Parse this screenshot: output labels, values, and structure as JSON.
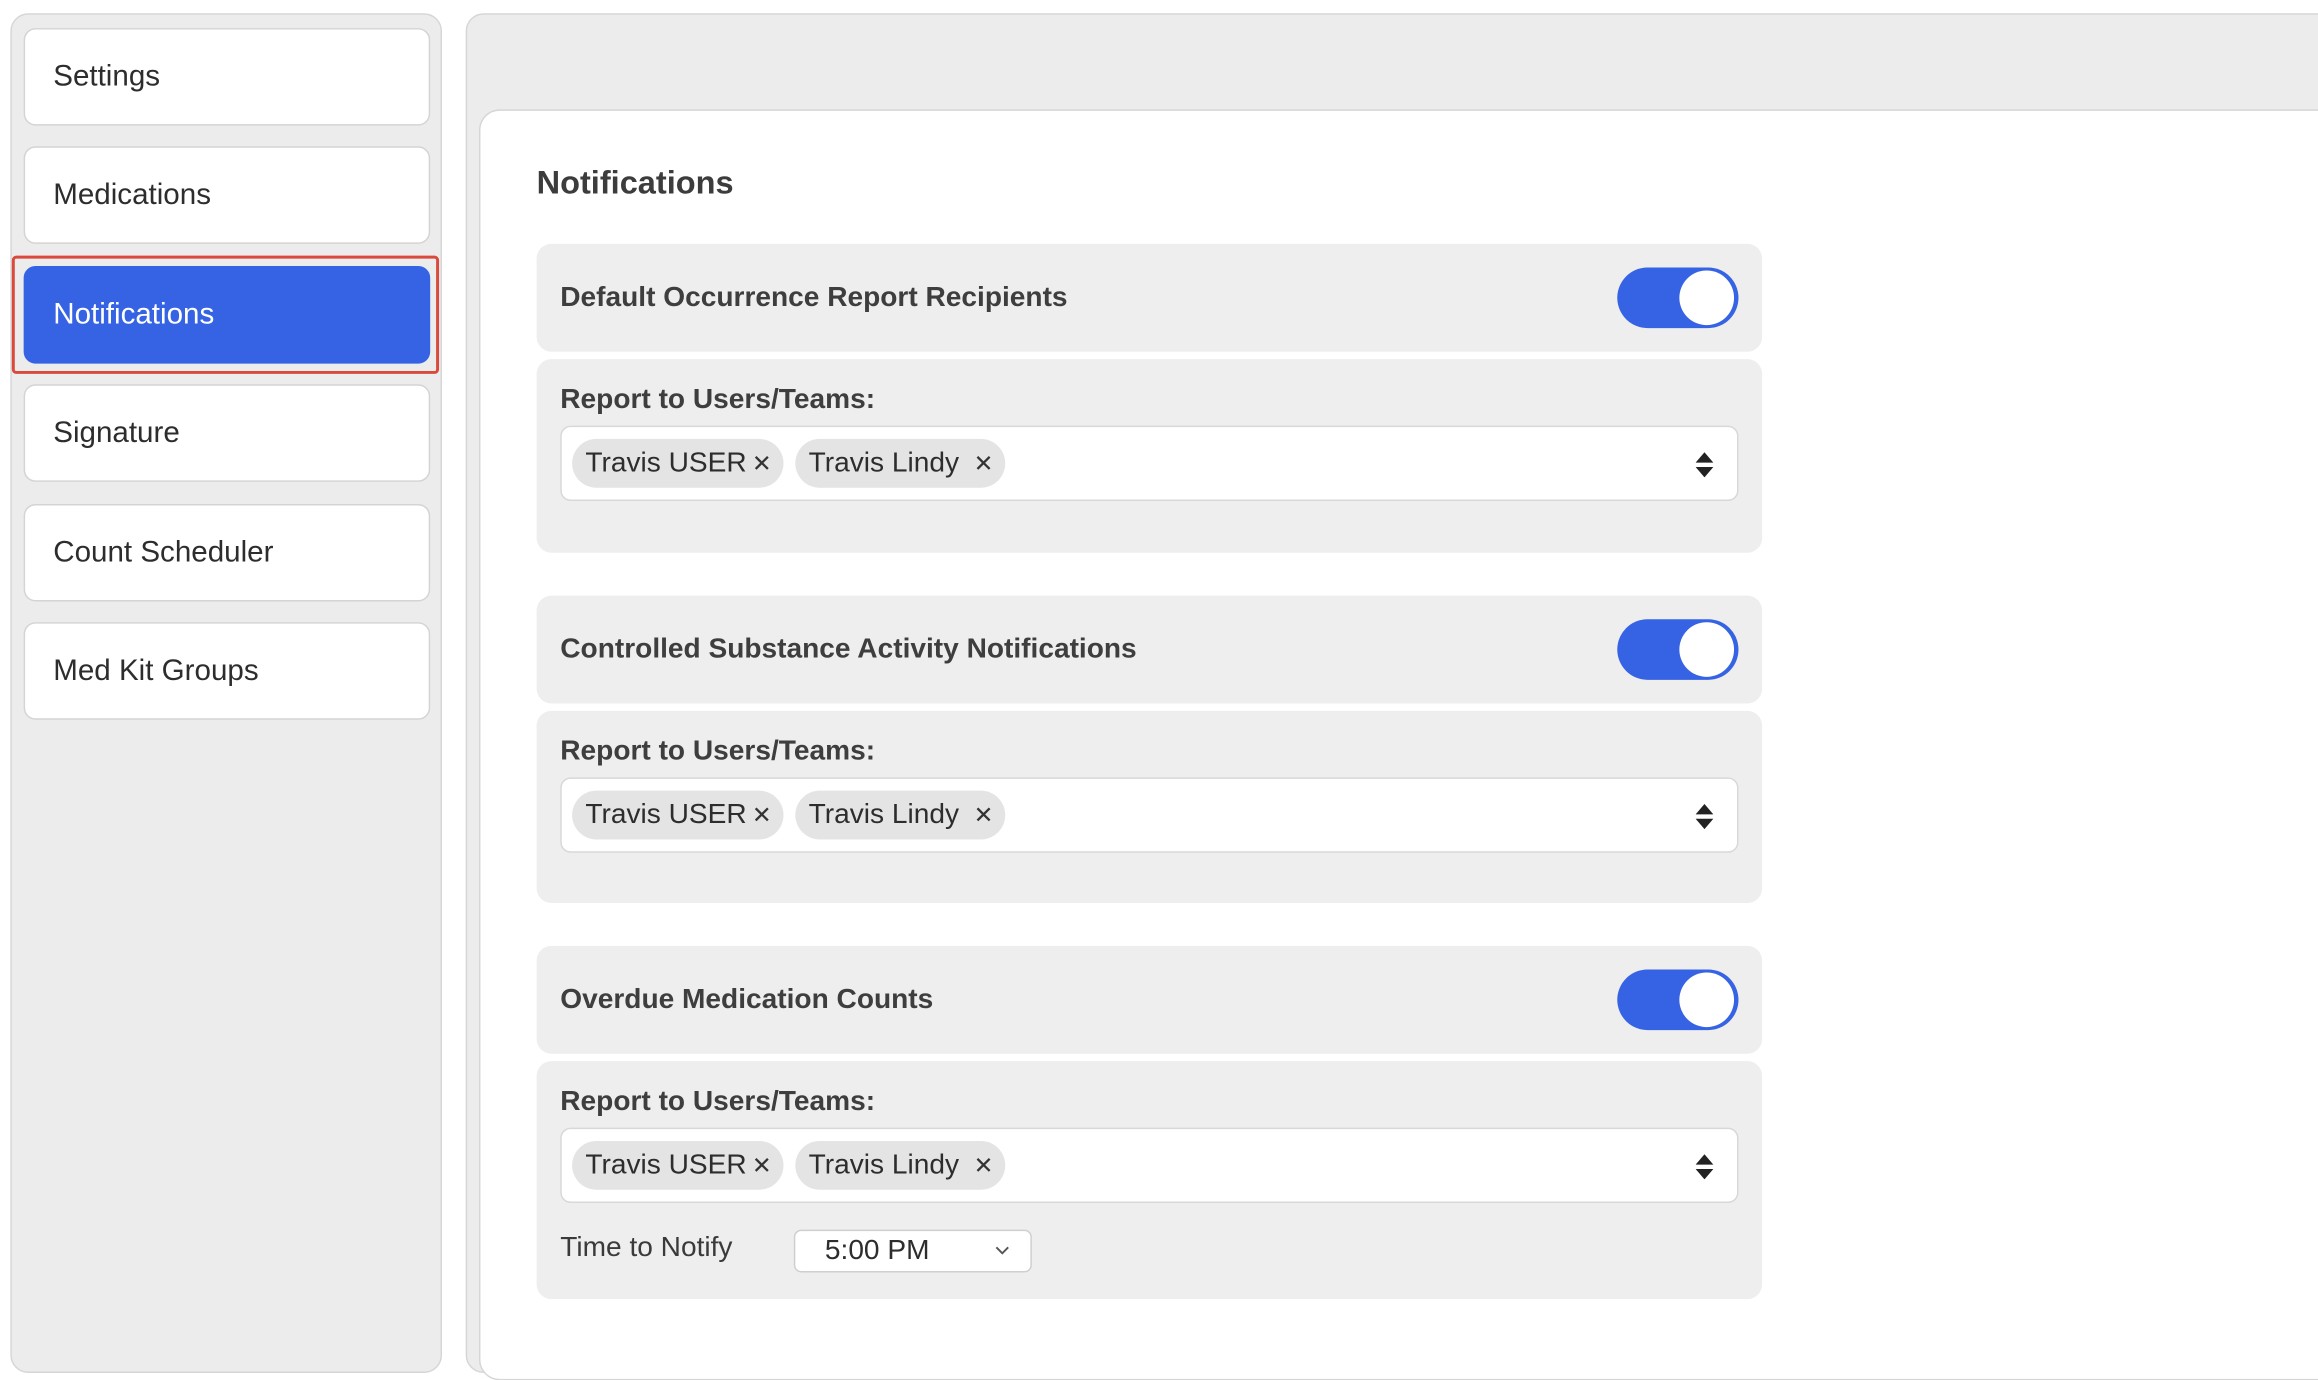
{
  "sidebar": {
    "items": [
      {
        "label": "Settings"
      },
      {
        "label": "Medications"
      },
      {
        "label": "Notifications"
      },
      {
        "label": "Signature"
      },
      {
        "label": "Count Scheduler"
      },
      {
        "label": "Med Kit Groups"
      }
    ],
    "active_item": "Notifications"
  },
  "main": {
    "title": "Notifications",
    "sections": [
      {
        "name": "Default Occurrence Report Recipients",
        "enabled": true,
        "recipients_label": "Report to Users/Teams:",
        "recipients": [
          "Travis USER",
          "Travis Lindy"
        ]
      },
      {
        "name": "Controlled Substance Activity Notifications",
        "enabled": true,
        "recipients_label": "Report to Users/Teams:",
        "recipients": [
          "Travis USER",
          "Travis Lindy"
        ]
      },
      {
        "name": "Overdue Medication Counts",
        "enabled": true,
        "recipients_label": "Report to Users/Teams:",
        "recipients": [
          "Travis USER",
          "Travis Lindy"
        ],
        "time_label": "Time to Notify",
        "time_value": "5:00 PM"
      }
    ]
  },
  "colors": {
    "accent": "#3563e3",
    "highlight_border": "#d94a3d",
    "panel_bg": "#eeeeee"
  },
  "icons": {
    "chip_remove": "close-icon",
    "select_indicator": "sort-icon",
    "dropdown": "chevron-down-icon"
  }
}
